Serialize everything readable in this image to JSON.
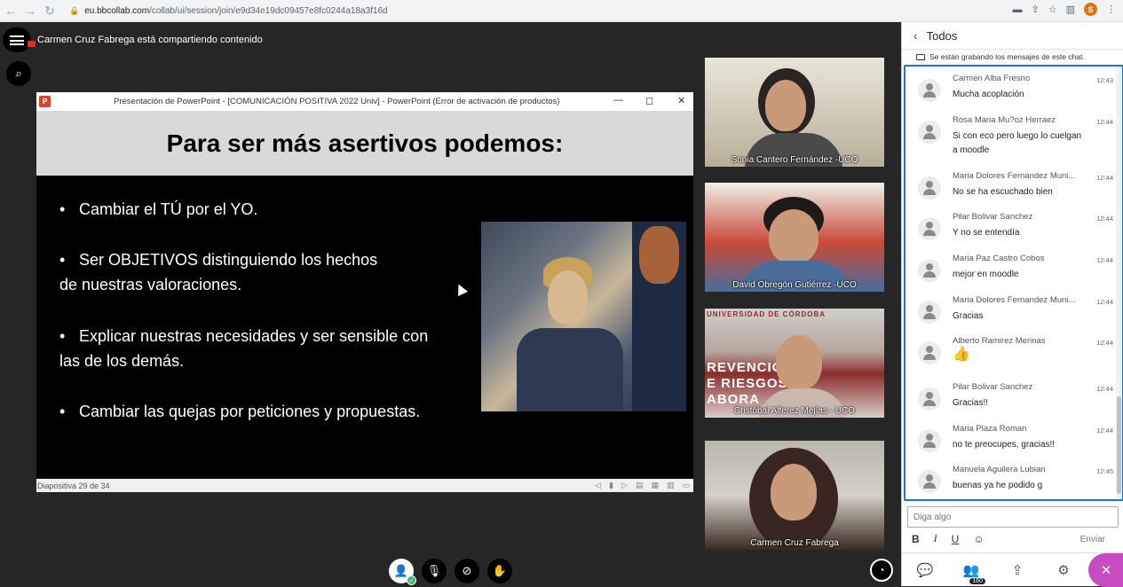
{
  "browser": {
    "url_host": "eu.bbcollab.com",
    "url_path": "/collab/ui/session/join/e9d34e19dc09457e8fc0244a18a3f16d",
    "profile_initial": "S"
  },
  "header": {
    "sharing_text": "Carmen Cruz Fabrega está compartiendo contenido"
  },
  "ppt": {
    "window_title": "Presentación de PowerPoint - [COMUNICACIÓN POSITIVA 2022 Univ] - PowerPoint (Error de activación de productos)",
    "slide_title": "Para ser más asertivos podemos:",
    "bullets": [
      {
        "line1": "Cambiar el TÚ por el YO.",
        "line2": ""
      },
      {
        "line1": "Ser OBJETIVOS distinguiendo los hechos",
        "line2": "de nuestras valoraciones."
      },
      {
        "line1": "Explicar nuestras necesidades y ser sensible con",
        "line2": "las de los demás."
      },
      {
        "line1": "Cambiar las quejas por peticiones y propuestas.",
        "line2": ""
      }
    ],
    "status": "Diapositiva 29 de 34"
  },
  "participants": [
    {
      "name": "Sonia Cantero Fernández -UCO"
    },
    {
      "name": "David Obregón Gutiérrez -UCO"
    },
    {
      "name": "Cristóbal Alferez Mejías - UCO",
      "banner": [
        "UNIVERSIDAD DE CÓRDOBA",
        "REVENCIÓN",
        "E RIESGOS",
        "ABORA"
      ]
    },
    {
      "name": "Carmen Cruz Fabrega"
    }
  ],
  "chat": {
    "title": "Todos",
    "recording_note": "Se están grabando los mensajes de este chat.",
    "messages": [
      {
        "author": "Carmen Alba Fresno",
        "time": "12:43",
        "text": "Mucha acoplación"
      },
      {
        "author": "Rosa Maria Mu?oz Herraez",
        "time": "12:44",
        "text": "Si con eco pero luego lo cuelgan a moodle"
      },
      {
        "author": "Maria Dolores Fernandez Muni...",
        "time": "12:44",
        "text": "No se ha escuchado bien"
      },
      {
        "author": "Pilar Bolivar Sanchez",
        "time": "12:44",
        "text": "Y no se entendía"
      },
      {
        "author": "Maria Paz Castro Cobos",
        "time": "12:44",
        "text": "mejor en moodle"
      },
      {
        "author": "Maria Dolores Fernandez Muni...",
        "time": "12:44",
        "text": "Gracias"
      },
      {
        "author": "Alberto Ramirez Merinas",
        "time": "12:44",
        "text": "👍"
      },
      {
        "author": "Pilar Bolivar Sanchez",
        "time": "12:44",
        "text": "Gracias!!"
      },
      {
        "author": "Maria Plaza Roman",
        "time": "12:44",
        "text": "no te preocupes, gracias!!"
      },
      {
        "author": "Manuela Aguilera Lubian",
        "time": "12:45",
        "text": "buenas ya he podido g"
      }
    ],
    "input_placeholder": "Diga algo",
    "send_label": "Enviar",
    "format": {
      "bold": "B",
      "italic": "I",
      "underline": "U"
    },
    "attendee_count": "160"
  }
}
